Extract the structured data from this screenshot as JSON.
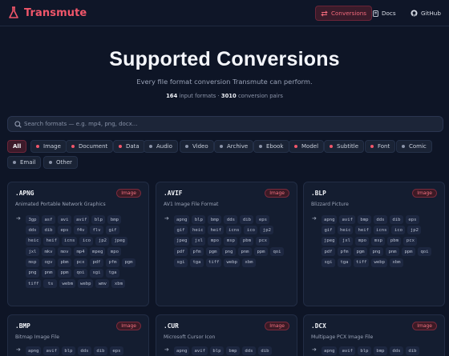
{
  "brand": {
    "name": "Transmute",
    "accent": "#f0566a"
  },
  "nav": {
    "conversions": "Conversions",
    "docs": "Docs",
    "github": "GitHub"
  },
  "hero": {
    "title": "Supported Conversions",
    "subtitle": "Every file format conversion Transmute can perform.",
    "input_count": "164",
    "input_label": "input formats",
    "separator": "·",
    "pair_count": "3010",
    "pair_label": "conversion pairs"
  },
  "search": {
    "placeholder": "Search formats — e.g. mp4, png, docx..."
  },
  "filters": [
    {
      "label": "All",
      "color": ""
    },
    {
      "label": "Image",
      "color": "#f0566a"
    },
    {
      "label": "Document",
      "color": "#f0566a"
    },
    {
      "label": "Data",
      "color": "#f0566a"
    },
    {
      "label": "Audio",
      "color": "#8a93a8"
    },
    {
      "label": "Video",
      "color": "#8a93a8"
    },
    {
      "label": "Archive",
      "color": "#8a93a8"
    },
    {
      "label": "Ebook",
      "color": "#8a93a8"
    },
    {
      "label": "Model",
      "color": "#f0566a"
    },
    {
      "label": "Subtitle",
      "color": "#f0566a"
    },
    {
      "label": "Font",
      "color": "#f0566a"
    },
    {
      "label": "Comic",
      "color": "#8a93a8"
    },
    {
      "label": "Email",
      "color": "#8a93a8"
    },
    {
      "label": "Other",
      "color": "#8a93a8"
    }
  ],
  "cards": [
    {
      "ext": ".APNG",
      "badge": "Image",
      "desc": "Animated Portable Network Graphics",
      "targets": [
        "3gp",
        "asf",
        "avi",
        "avif",
        "blp",
        "bmp",
        "dds",
        "dib",
        "eps",
        "f4v",
        "flv",
        "gif",
        "heic",
        "heif",
        "icns",
        "ico",
        "jp2",
        "jpeg",
        "jxl",
        "mkv",
        "mov",
        "mp4",
        "mpeg",
        "mpo",
        "msp",
        "ogv",
        "pbm",
        "pcx",
        "pdf",
        "pfm",
        "pgm",
        "png",
        "pnm",
        "ppm",
        "qoi",
        "sgi",
        "tga",
        "tiff",
        "ts",
        "webm",
        "webp",
        "wmv",
        "xbm"
      ]
    },
    {
      "ext": ".AVIF",
      "badge": "Image",
      "desc": "AV1 Image File Format",
      "targets": [
        "apng",
        "blp",
        "bmp",
        "dds",
        "dib",
        "eps",
        "gif",
        "heic",
        "heif",
        "icns",
        "ico",
        "jp2",
        "jpeg",
        "jxl",
        "mpo",
        "msp",
        "pbm",
        "pcx",
        "pdf",
        "pfm",
        "pgm",
        "png",
        "pnm",
        "ppm",
        "qoi",
        "sgi",
        "tga",
        "tiff",
        "webp",
        "xbm"
      ]
    },
    {
      "ext": ".BLP",
      "badge": "Image",
      "desc": "Blizzard Picture",
      "targets": [
        "apng",
        "avif",
        "bmp",
        "dds",
        "dib",
        "eps",
        "gif",
        "heic",
        "heif",
        "icns",
        "ico",
        "jp2",
        "jpeg",
        "jxl",
        "mpo",
        "msp",
        "pbm",
        "pcx",
        "pdf",
        "pfm",
        "pgm",
        "png",
        "pnm",
        "ppm",
        "qoi",
        "sgi",
        "tga",
        "tiff",
        "webp",
        "xbm"
      ]
    },
    {
      "ext": ".BMP",
      "badge": "Image",
      "desc": "Bitmap Image File",
      "targets": [
        "apng",
        "avif",
        "blp",
        "dds",
        "dib",
        "eps"
      ]
    },
    {
      "ext": ".CUR",
      "badge": "Image",
      "desc": "Microsoft Cursor Icon",
      "targets": [
        "apng",
        "avif",
        "blp",
        "bmp",
        "dds",
        "dib"
      ]
    },
    {
      "ext": ".DCX",
      "badge": "Image",
      "desc": "Multipage PCX Image File",
      "targets": [
        "apng",
        "avif",
        "blp",
        "bmp",
        "dds",
        "dib"
      ]
    }
  ]
}
